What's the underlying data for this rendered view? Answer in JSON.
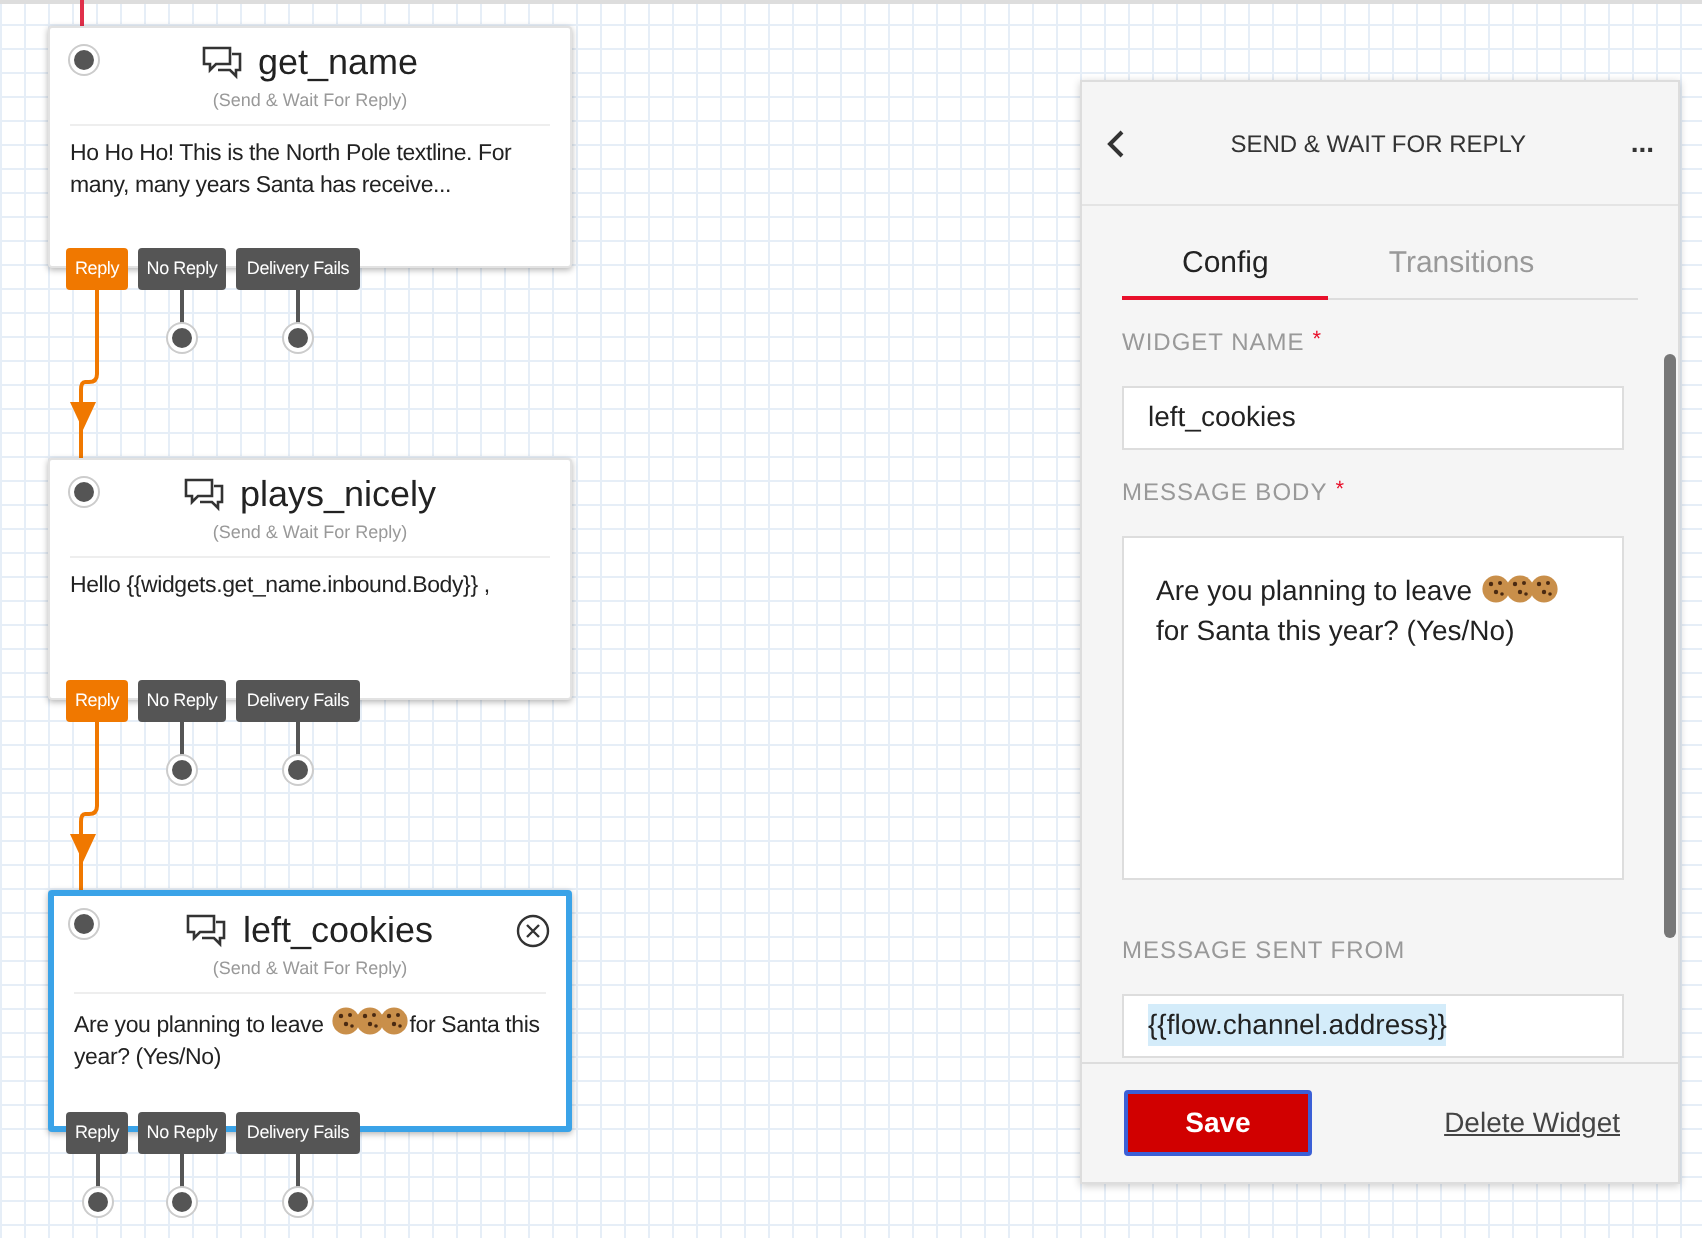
{
  "widgets": [
    {
      "title": "get_name",
      "subtitle": "(Send & Wait For Reply)",
      "selected": false,
      "message": [
        {
          "kind": "text",
          "text": "Ho Ho Ho! This is the North Pole textline. For many, many years Santa has receive..."
        }
      ],
      "transitions": [
        {
          "label": "Reply",
          "connected": true
        },
        {
          "label": "No Reply",
          "connected": false
        },
        {
          "label": "Delivery Fails",
          "connected": false
        }
      ]
    },
    {
      "title": "plays_nicely",
      "subtitle": "(Send & Wait For Reply)",
      "selected": false,
      "message": [
        {
          "kind": "text",
          "text": "Hello {{widgets.get_name.inbound.Body}} ,"
        }
      ],
      "transitions": [
        {
          "label": "Reply",
          "connected": true
        },
        {
          "label": "No Reply",
          "connected": false
        },
        {
          "label": "Delivery Fails",
          "connected": false
        }
      ]
    },
    {
      "title": "left_cookies",
      "subtitle": "(Send & Wait For Reply)",
      "selected": true,
      "message": [
        {
          "kind": "text",
          "text": "Are you planning to leave "
        },
        {
          "kind": "cookies"
        },
        {
          "kind": "text",
          "text": "for Santa this year? (Yes/No)"
        }
      ],
      "transitions": [
        {
          "label": "Reply",
          "connected": false
        },
        {
          "label": "No Reply",
          "connected": false
        },
        {
          "label": "Delivery Fails",
          "connected": false
        }
      ]
    }
  ],
  "panel": {
    "title": "SEND & WAIT FOR REPLY",
    "more": "...",
    "tabs": [
      {
        "label": "Config",
        "selected": true
      },
      {
        "label": "Transitions",
        "selected": false
      }
    ],
    "fields": [
      {
        "kind": "input",
        "label": "WIDGET NAME",
        "required_mark": "*",
        "value": "left_cookies"
      },
      {
        "kind": "textarea",
        "label": "MESSAGE BODY",
        "required_mark": "*",
        "value": [
          {
            "kind": "text",
            "text": "Are you planning to leave "
          },
          {
            "kind": "cookies"
          },
          {
            "kind": "text",
            "text": " for Santa this year? (Yes/No)"
          }
        ]
      },
      {
        "kind": "input",
        "label": "MESSAGE SENT FROM",
        "value": "{{flow.channel.address}}"
      }
    ],
    "save": "Save",
    "delete": "Delete Widget"
  }
}
